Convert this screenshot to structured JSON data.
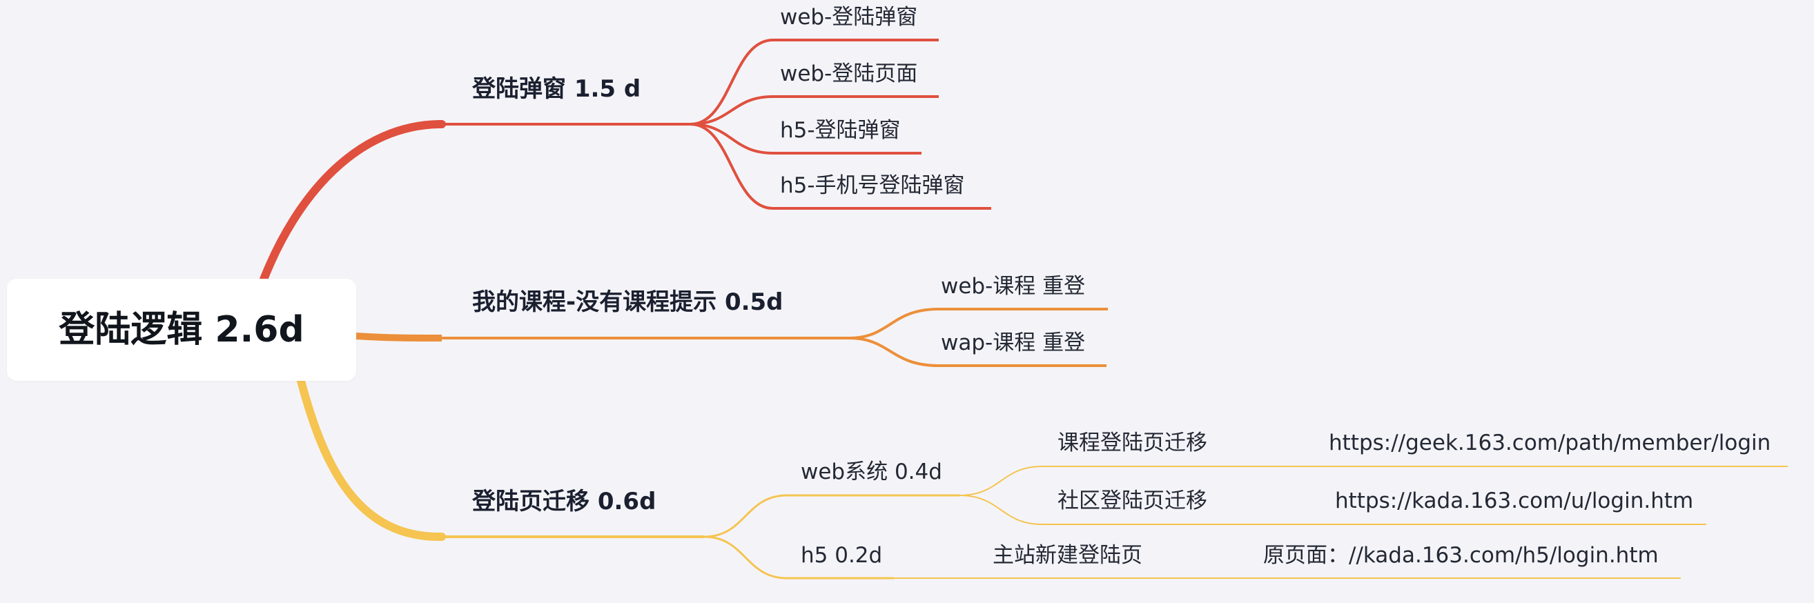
{
  "root": {
    "label": "登陆逻辑 2.6d"
  },
  "colors": {
    "branch_login_popup": "#e0503f",
    "branch_my_course": "#ec8f3a",
    "branch_login_migration": "#f5c451",
    "background": "#f4f4f8"
  },
  "branches": [
    {
      "label": "登陆弹窗 1.5 d",
      "children": [
        {
          "label": "web-登陆弹窗"
        },
        {
          "label": "web-登陆页面"
        },
        {
          "label": "h5-登陆弹窗"
        },
        {
          "label": "h5-手机号登陆弹窗"
        }
      ]
    },
    {
      "label": "我的课程-没有课程提示 0.5d",
      "children": [
        {
          "label": "web-课程 重登"
        },
        {
          "label": "wap-课程 重登"
        }
      ]
    },
    {
      "label": "登陆页迁移 0.6d",
      "children": [
        {
          "label": "web系统 0.4d",
          "children": [
            {
              "label": "课程登陆页迁移",
              "note": "https://geek.163.com/path/member/login"
            },
            {
              "label": "社区登陆页迁移",
              "note": "https://kada.163.com/u/login.htm"
            }
          ]
        },
        {
          "label": "h5 0.2d",
          "children": [
            {
              "label": "主站新建登陆页",
              "note": "原页面：//kada.163.com/h5/login.htm"
            }
          ]
        }
      ]
    }
  ]
}
